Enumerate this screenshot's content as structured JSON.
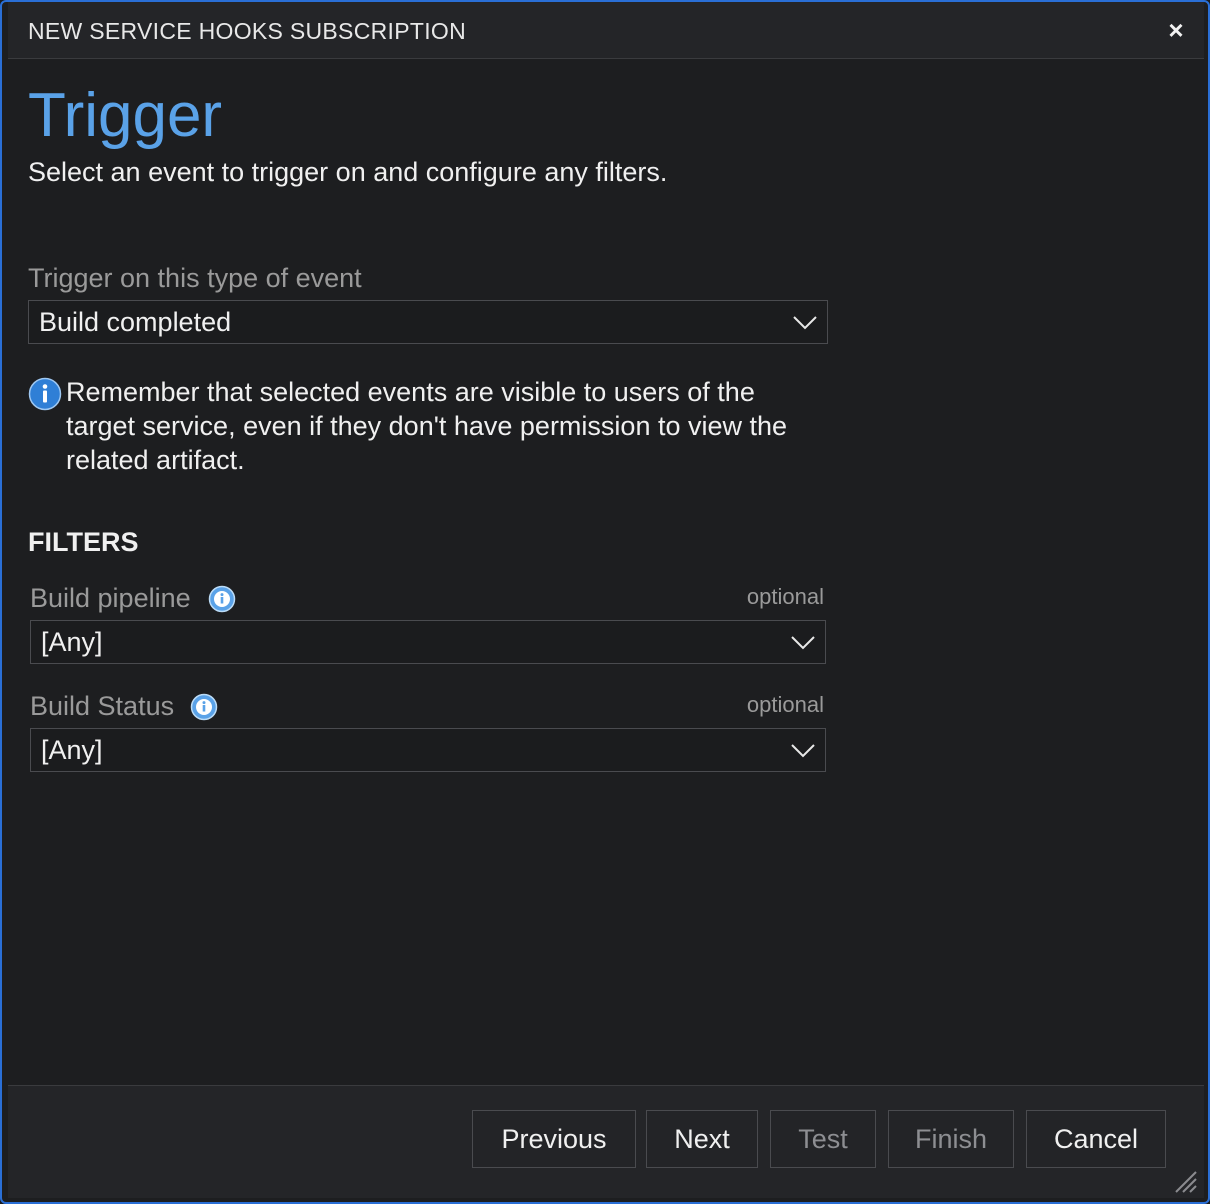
{
  "dialog": {
    "title": "NEW SERVICE HOOKS SUBSCRIPTION",
    "close_glyph": "×"
  },
  "page": {
    "heading": "Trigger",
    "subtitle": "Select an event to trigger on and configure any filters."
  },
  "event": {
    "label": "Trigger on this type of event",
    "selected": "Build completed"
  },
  "notice": {
    "text": "Remember that selected events are visible to users of the target service, even if they don't have permission to view the related artifact."
  },
  "filters": {
    "heading": "FILTERS",
    "build_pipeline": {
      "label": "Build pipeline",
      "optional": "optional",
      "selected": "[Any]"
    },
    "build_status": {
      "label": "Build Status",
      "optional": "optional",
      "selected": "[Any]"
    }
  },
  "footer": {
    "previous": "Previous",
    "next": "Next",
    "test": "Test",
    "finish": "Finish",
    "cancel": "Cancel"
  },
  "colors": {
    "accent": "#5aa2e8",
    "dialog_border": "#2a6fd6",
    "background": "#1d1e20"
  }
}
